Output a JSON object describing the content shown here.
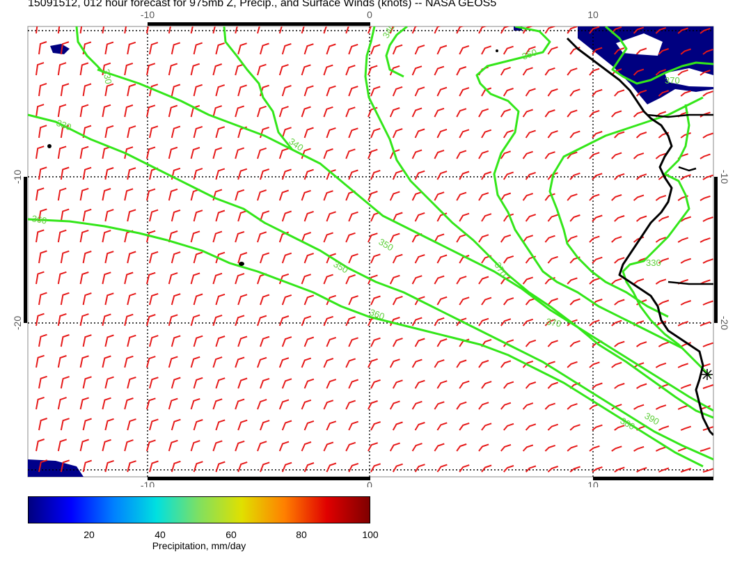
{
  "title": "15091512, 012 hour forecast for 975mb Z, Precip., and Surface Winds (knots) -- NASA GEOS5",
  "map": {
    "lon_ticks": [
      "-10",
      "0",
      "10"
    ],
    "lat_ticks": [
      "-10",
      "-20"
    ],
    "contour_labels": [
      "330",
      "330",
      "340",
      "340",
      "350",
      "350",
      "350",
      "360",
      "360",
      "370",
      "370",
      "380",
      "390",
      "330",
      "370"
    ],
    "colors": {
      "contour": "#33e619",
      "wind_barb": "#e61919",
      "coastline": "#000000",
      "precip_low": "#00007a"
    },
    "features": [
      "wind-barbs",
      "geopotential-height-contours",
      "precipitation-shading",
      "coastline"
    ]
  },
  "colorbar": {
    "ticks": [
      "20",
      "40",
      "60",
      "80",
      "100"
    ],
    "tick_values": [
      20,
      40,
      60,
      80,
      100
    ],
    "range": [
      4,
      100
    ],
    "label": "Precipitation, mm/day",
    "colors": [
      "#00007f",
      "#0000ff",
      "#0080ff",
      "#00e0e0",
      "#80e060",
      "#e0e000",
      "#ff8000",
      "#e00000",
      "#7f0000"
    ]
  }
}
